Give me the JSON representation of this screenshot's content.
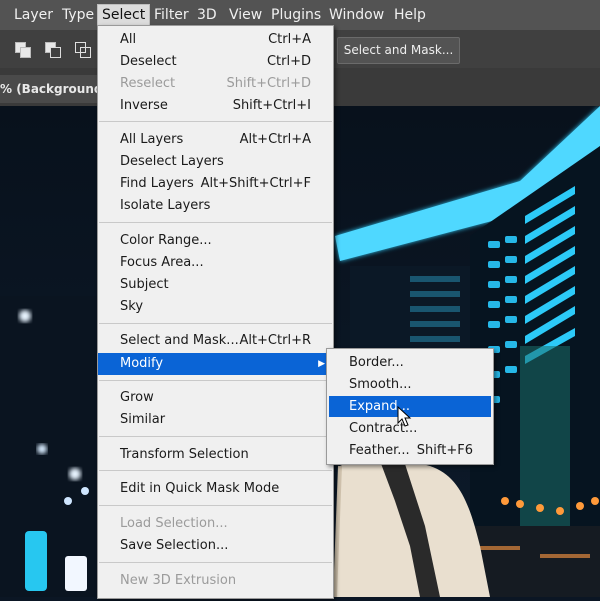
{
  "menubar": {
    "items": [
      "Layer",
      "Type",
      "Select",
      "Filter",
      "3D",
      "View",
      "Plugins",
      "Window",
      "Help"
    ],
    "active": "Select"
  },
  "options_bar": {
    "select_and_mask_button": "Select and Mask..."
  },
  "document_tab": {
    "title": "% (Background,"
  },
  "select_menu": {
    "items": [
      {
        "label": "All",
        "shortcut": "Ctrl+A",
        "disabled": false
      },
      {
        "label": "Deselect",
        "shortcut": "Ctrl+D",
        "disabled": false
      },
      {
        "label": "Reselect",
        "shortcut": "Shift+Ctrl+D",
        "disabled": true
      },
      {
        "label": "Inverse",
        "shortcut": "Shift+Ctrl+I",
        "disabled": false
      },
      {
        "label": "All Layers",
        "shortcut": "Alt+Ctrl+A",
        "disabled": false
      },
      {
        "label": "Deselect Layers",
        "shortcut": "",
        "disabled": false
      },
      {
        "label": "Find Layers",
        "shortcut": "Alt+Shift+Ctrl+F",
        "disabled": false
      },
      {
        "label": "Isolate Layers",
        "shortcut": "",
        "disabled": false
      },
      {
        "label": "Color Range...",
        "shortcut": "",
        "disabled": false
      },
      {
        "label": "Focus Area...",
        "shortcut": "",
        "disabled": false
      },
      {
        "label": "Subject",
        "shortcut": "",
        "disabled": false
      },
      {
        "label": "Sky",
        "shortcut": "",
        "disabled": false
      },
      {
        "label": "Select and Mask...",
        "shortcut": "Alt+Ctrl+R",
        "disabled": false
      },
      {
        "label": "Modify",
        "shortcut": "",
        "disabled": false,
        "highlighted": true,
        "submenu": true
      },
      {
        "label": "Grow",
        "shortcut": "",
        "disabled": false
      },
      {
        "label": "Similar",
        "shortcut": "",
        "disabled": false
      },
      {
        "label": "Transform Selection",
        "shortcut": "",
        "disabled": false
      },
      {
        "label": "Edit in Quick Mask Mode",
        "shortcut": "",
        "disabled": false
      },
      {
        "label": "Load Selection...",
        "shortcut": "",
        "disabled": true
      },
      {
        "label": "Save Selection...",
        "shortcut": "",
        "disabled": false
      },
      {
        "label": "New 3D Extrusion",
        "shortcut": "",
        "disabled": true
      }
    ]
  },
  "modify_submenu": {
    "items": [
      {
        "label": "Border...",
        "shortcut": ""
      },
      {
        "label": "Smooth...",
        "shortcut": ""
      },
      {
        "label": "Expand...",
        "shortcut": "",
        "highlighted": true
      },
      {
        "label": "Contract...",
        "shortcut": ""
      },
      {
        "label": "Feather...",
        "shortcut": "Shift+F6"
      }
    ]
  },
  "colors": {
    "highlight": "#0a64d6",
    "menu_bg": "#f0f0f0",
    "menubar_bg": "#535353",
    "neon": "#2fd0ff"
  }
}
